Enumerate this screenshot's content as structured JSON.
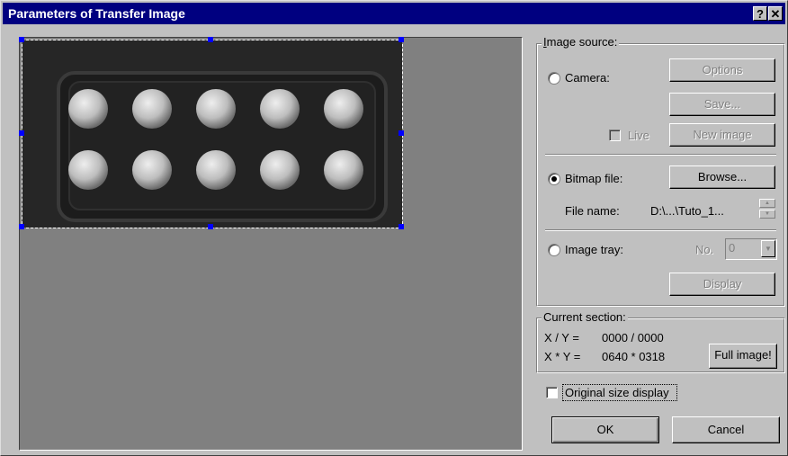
{
  "window": {
    "title": "Parameters of Transfer Image",
    "help_glyph": "?",
    "close_glyph": "✕"
  },
  "image_source": {
    "legend": "Image source:",
    "camera_label": "Camera:",
    "camera_selected": false,
    "options_label": "Options",
    "save_label": "Save...",
    "live_label": "Live",
    "live_checked": false,
    "new_image_label": "New image",
    "bitmap_label": "Bitmap file:",
    "bitmap_selected": true,
    "browse_label": "Browse...",
    "file_name_label": "File name:",
    "file_name_value": "D:\\...\\Tuto_1...",
    "image_tray_label": "Image tray:",
    "image_tray_selected": false,
    "no_label": "No.",
    "no_value": "0",
    "display_label": "Display"
  },
  "current_section": {
    "legend": "Current section:",
    "xy_label": "X / Y =",
    "xy_value": "0000 / 0000",
    "size_label": "X * Y =",
    "size_value": "0640 * 0318",
    "full_image_label": "Full image!"
  },
  "options": {
    "original_size_label": "Original size display",
    "original_size_checked": false
  },
  "footer": {
    "ok_label": "OK",
    "cancel_label": "Cancel"
  },
  "colors": {
    "titlebar": "#000080",
    "selection_handles": "#0000ff",
    "preview_background": "#808080"
  },
  "preview_image": {
    "rows": 2,
    "tablets_per_row": 5
  }
}
